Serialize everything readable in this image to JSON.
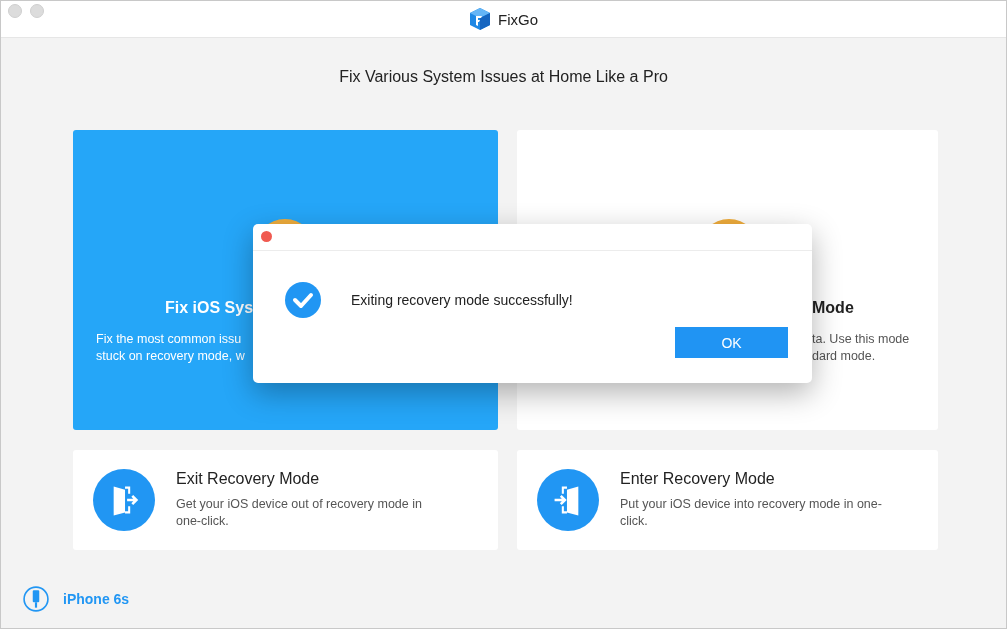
{
  "window": {
    "title": "FixGo"
  },
  "heading": "Fix Various System Issues at Home Like a Pro",
  "main_cards": [
    {
      "selected": true,
      "title": "Fix iOS Sys",
      "description": [
        "Fix the most common issu",
        "stuck on recovery mode, w"
      ]
    },
    {
      "selected": false,
      "title": "Mode",
      "description": [
        "ta. Use this mode",
        "dard mode."
      ]
    }
  ],
  "small_cards": [
    {
      "kind": "exit",
      "title": "Exit Recovery Mode",
      "description": "Get your iOS device out of recovery mode in one-click."
    },
    {
      "kind": "enter",
      "title": "Enter Recovery Mode",
      "description": "Put your iOS device into recovery mode in one-click."
    }
  ],
  "device": {
    "name": "iPhone 6s"
  },
  "dialog": {
    "message": "Exiting recovery mode successfully!",
    "buttons": [
      "OK"
    ]
  }
}
